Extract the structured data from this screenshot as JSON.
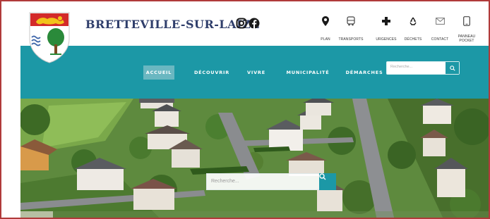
{
  "header": {
    "title": "BRETTEVILLE-SUR-LAIZE",
    "crest_icon": "coat-of-arms-icon",
    "social": [
      {
        "icon": "instagram-icon"
      },
      {
        "icon": "facebook-icon"
      }
    ],
    "quick_links": [
      {
        "label": "PLAN",
        "icon": "map-pin-icon"
      },
      {
        "label": "TRANSPORTS",
        "icon": "bus-icon"
      },
      {
        "label": "URGENCES",
        "icon": "medical-cross-icon"
      },
      {
        "label": "DÉCHETS",
        "icon": "recycle-icon"
      },
      {
        "label": "CONTACT",
        "icon": "envelope-icon"
      },
      {
        "label": "PANNEAU POCKET",
        "icon": "smartphone-icon"
      }
    ]
  },
  "nav": {
    "items": [
      {
        "label": "ACCUEIL",
        "active": true
      },
      {
        "label": "DÉCOUVRIR",
        "active": false
      },
      {
        "label": "VIVRE",
        "active": false
      },
      {
        "label": "MUNICIPALITÉ",
        "active": false
      },
      {
        "label": "DÉMARCHES",
        "active": false
      }
    ],
    "search_placeholder": "Recherche..."
  },
  "hero": {
    "search_placeholder": "Recherche..."
  },
  "colors": {
    "brand_teal": "#1c98a6",
    "title_navy": "#2f3e6b",
    "frame_red": "#b03a3a"
  }
}
